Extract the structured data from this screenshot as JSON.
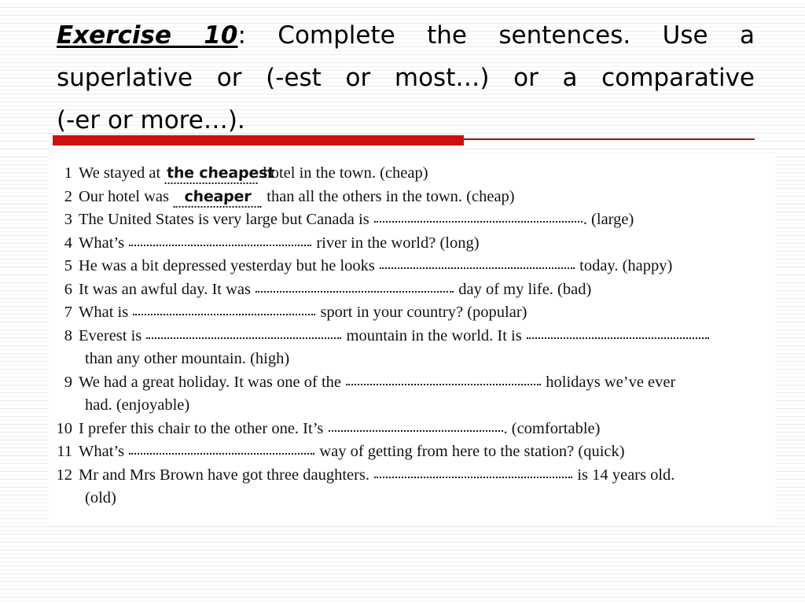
{
  "slide": {
    "background_color": "#ffffff",
    "stripe_color": "#ececed"
  },
  "title": {
    "exercise_label": "Exercise 10",
    "line1_rest": ": Complete the sentences. Use a",
    "line2": "superlative or (-est or most…) or a comparative",
    "line3": "(-er or more…).",
    "full_text": "Exercise 10: Complete the sentences. Use a superlative or (-est or most…) or a comparative (-er or more…)."
  },
  "divider": {
    "thick_color": "#cc1111",
    "thin_color": "#8c1a12"
  },
  "exercise": {
    "items": [
      {
        "number": "1",
        "before": "We stayed at",
        "blank_width": 118,
        "answer": "the cheapest",
        "after": "hotel in the town. (cheap)",
        "cue": "cheap"
      },
      {
        "number": "2",
        "before": "Our hotel was",
        "blank_width": 112,
        "answer": "cheaper",
        "after": "than all the others in the town. (cheap)",
        "cue": "cheap"
      },
      {
        "number": "3",
        "before": "The United States is very large but Canada is",
        "blank_width": 265,
        "answer": "",
        "after": ". (large)",
        "cue": "large"
      },
      {
        "number": "4",
        "before": "What’s",
        "blank_width": 232,
        "answer": "",
        "after": "river in the world? (long)",
        "cue": "long"
      },
      {
        "number": "5",
        "before": "He was a bit depressed yesterday but he looks",
        "blank_width": 248,
        "answer": "",
        "after": "today.   (happy)",
        "cue": "happy"
      },
      {
        "number": "6",
        "before": "It was an awful day. It was",
        "blank_width": 252,
        "answer": "",
        "after": "day of my life. (bad)",
        "cue": "bad"
      },
      {
        "number": "7",
        "before": "What is",
        "blank_width": 232,
        "answer": "",
        "after": "sport in your country? (popular)",
        "cue": "popular"
      },
      {
        "number": "8",
        "before": "Everest is",
        "blank_width": 248,
        "answer": "",
        "after": "mountain in the world. It is",
        "blank2_width": 232,
        "continuation": "than any other mountain. (high)",
        "cue": "high"
      },
      {
        "number": "9",
        "before": "We had a great holiday. It was one of the",
        "blank_width": 248,
        "answer": "",
        "after": "holidays we’ve ever",
        "continuation": "had. (enjoyable)",
        "cue": "enjoyable"
      },
      {
        "number": "10",
        "before": "I prefer this chair to the other one. It’s",
        "blank_width": 222,
        "answer": "",
        "after": ". (comfortable)",
        "cue": "comfortable"
      },
      {
        "number": "11",
        "before": "What’s",
        "blank_width": 236,
        "answer": "",
        "after": "way of getting from here to the station? (quick)",
        "cue": "quick"
      },
      {
        "number": "12",
        "before": "Mr and Mrs Brown have got three daughters.   ",
        "blank_width": 252,
        "answer": "",
        "after": "is 14 years old.",
        "continuation": "(old)",
        "cue": "old"
      }
    ]
  }
}
